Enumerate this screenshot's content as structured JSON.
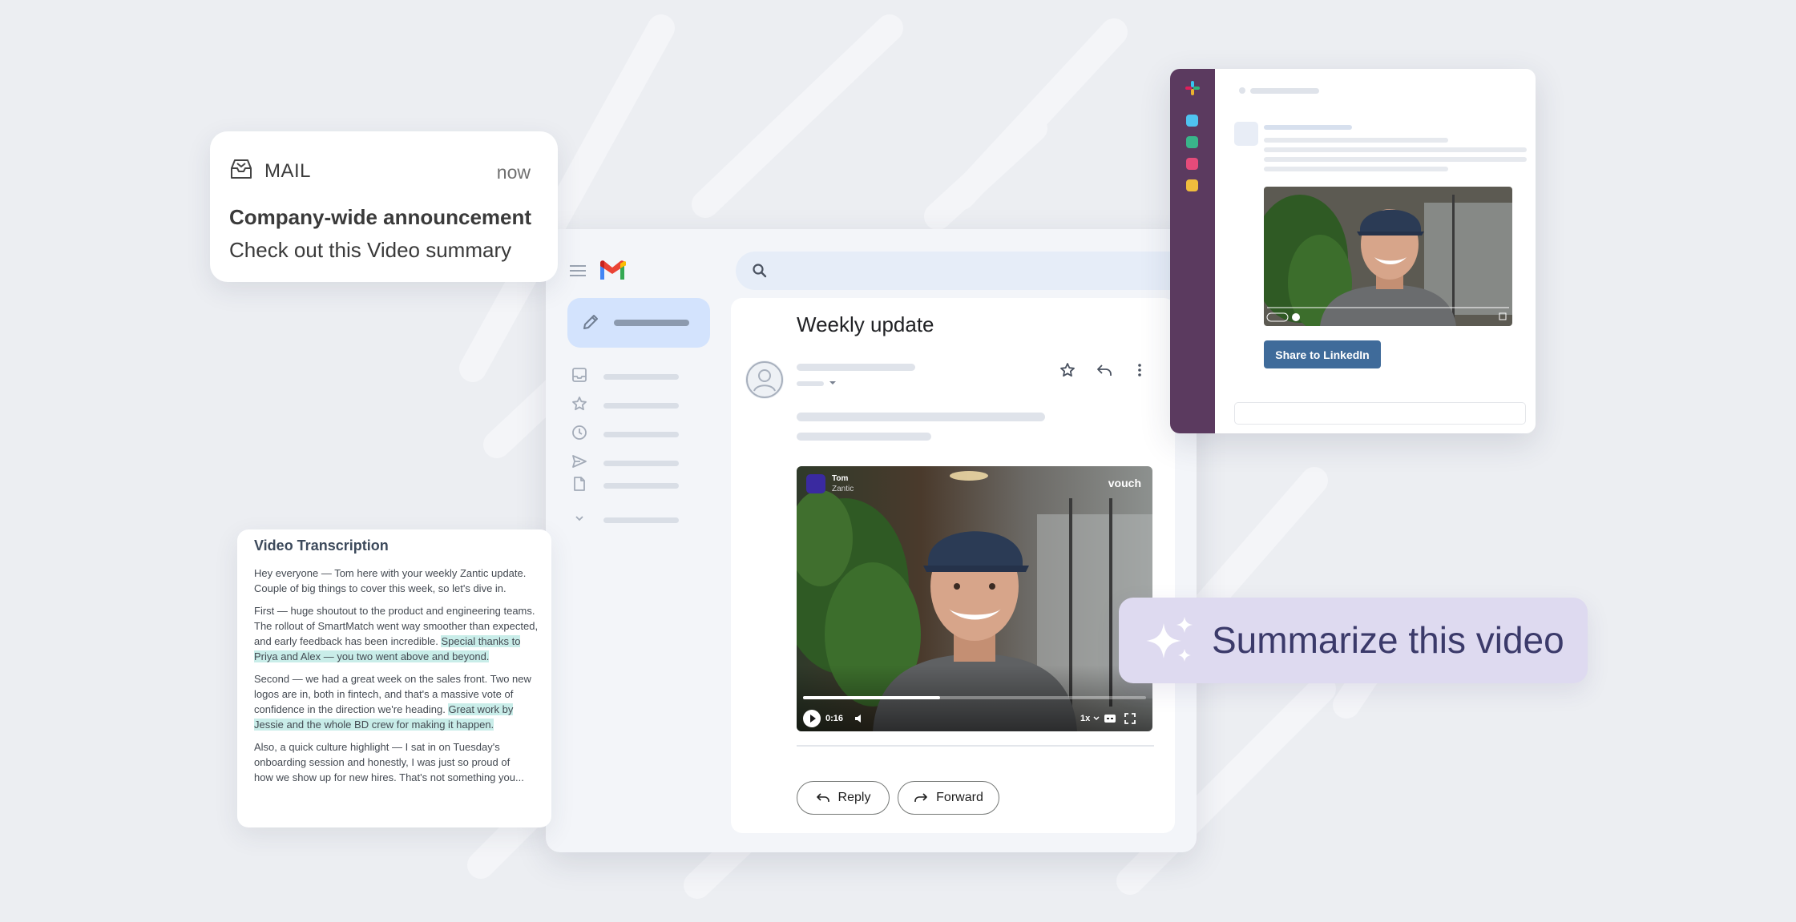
{
  "colors": {
    "background": "#eceef2",
    "gmail_compose": "#d3e3fd",
    "highlight": "#c9ede9",
    "slack_sidebar": "#5b3a5f",
    "slack_button": "#3f6b9a",
    "summarize_bg": "#dedaf0",
    "summarize_text": "#3b3a6a"
  },
  "notification": {
    "icon": "mail-inbox-icon",
    "app": "MAIL",
    "time": "now",
    "title": "Company-wide announcement",
    "body": "Check out this Video summary"
  },
  "gmail": {
    "menu_icon": "hamburger-menu-icon",
    "logo": "gmail-logo",
    "search_icon": "search-icon",
    "nav_icons": [
      "inbox-icon",
      "star-icon",
      "clock-icon",
      "send-icon",
      "file-icon",
      "chevron-down-icon"
    ],
    "subject": "Weekly update",
    "actions": [
      "star-icon",
      "reply-icon",
      "more-vertical-icon"
    ],
    "video": {
      "sender_name": "Tom",
      "sender_company": "Zantic",
      "brand": "vouch",
      "time": "0:16",
      "speed": "1x",
      "progress": 0.4
    },
    "reply_label": "Reply",
    "forward_label": "Forward"
  },
  "transcription": {
    "title": "Video Transcription",
    "p1": "Hey everyone — Tom here with your weekly Zantic update. Couple of big things to cover this week, so let's dive in.",
    "p2_plain": "First — huge shoutout to the product and engineering teams. The rollout of SmartMatch went way smoother than expected, and early feedback has been incredible.",
    "p2_highlight": "Special thanks to Priya and Alex — you two went above and beyond.",
    "p3_plain": "Second — we had a great week on the sales front. Two new logos are in, both in fintech, and that's a massive vote of confidence in the direction we're heading.",
    "p3_highlight": "Great work by Jessie and the whole BD crew for making it happen.",
    "p4_line1": "Also, a quick culture highlight — I sat in on Tuesday's",
    "p4_line2": "onboarding session and honestly, I was just so proud of",
    "p4_line3": "how we show up for new hires. That's not something you..."
  },
  "slack": {
    "logo": "slack-logo",
    "share_label": "Share to LinkedIn"
  },
  "summarize": {
    "icon": "sparkles-icon",
    "label": "Summarize this video"
  }
}
